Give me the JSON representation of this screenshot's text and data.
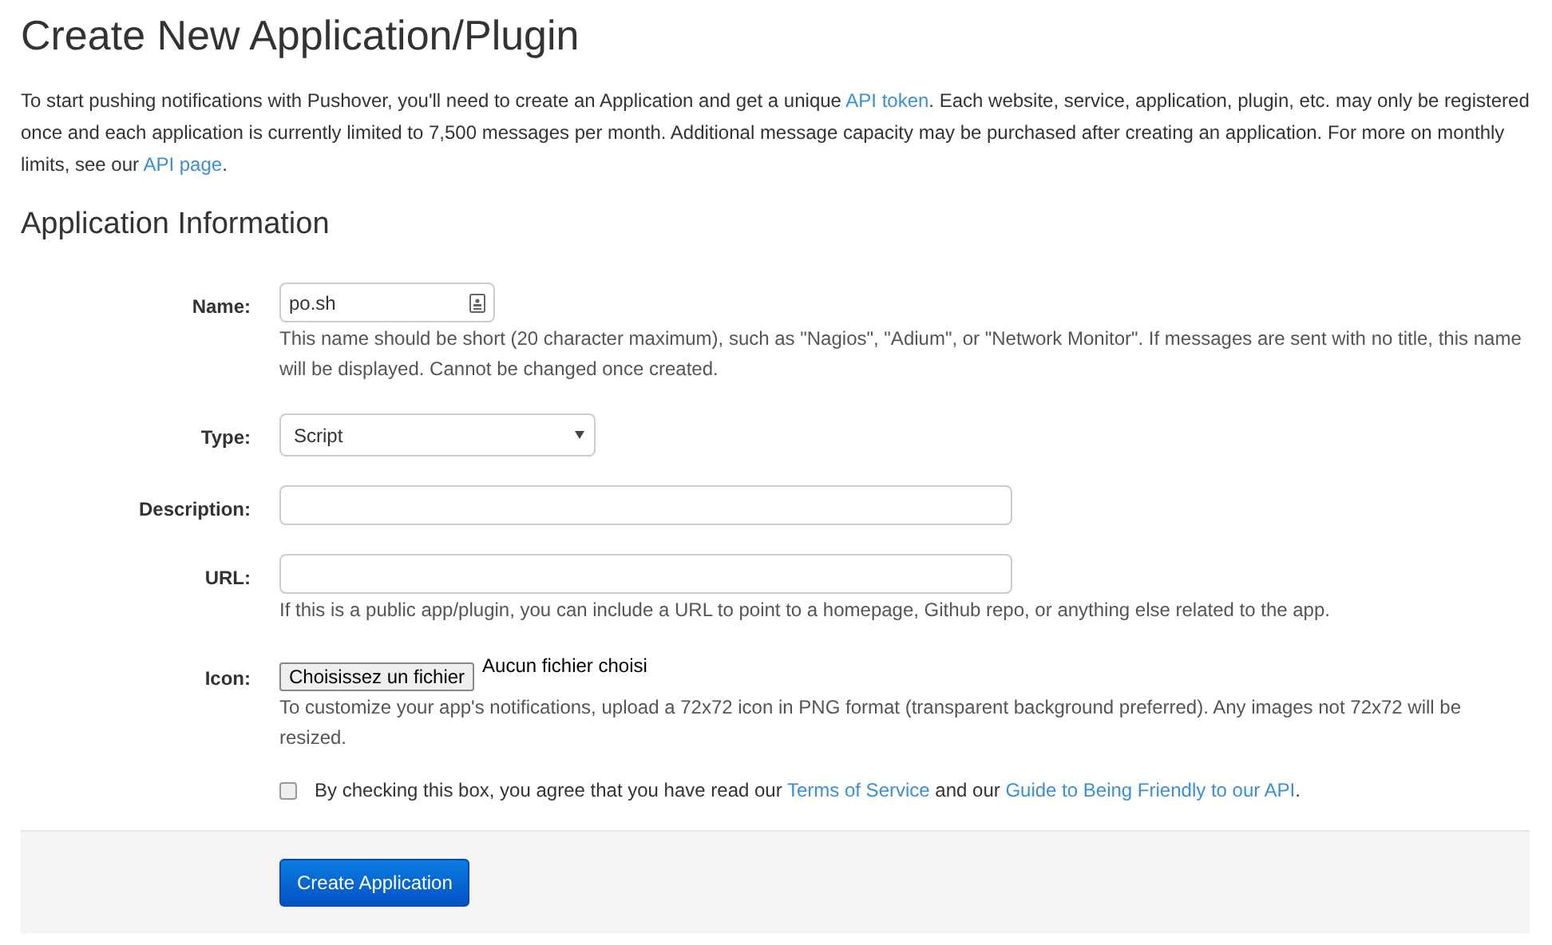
{
  "title": "Create New Application/Plugin",
  "intro": [
    {
      "kind": "text",
      "text": "To start pushing notifications with Pushover, you'll need to create an Application and get a unique "
    },
    {
      "kind": "link",
      "text": "API token"
    },
    {
      "kind": "text",
      "text": ". Each website, service, application, plugin, etc. may only be registered once and each application is currently limited to 7,500 messages per month. Additional message capacity may be purchased after creating an application. For more on monthly limits, see our "
    },
    {
      "kind": "link",
      "text": "API page"
    },
    {
      "kind": "text",
      "text": "."
    }
  ],
  "section_title": "Application Information",
  "fields": [
    {
      "kind": "short_text",
      "label": "Name:",
      "value": "po.sh",
      "help": "This name should be short (20 character maximum), such as \"Nagios\", \"Adium\", or \"Network Monitor\". If messages are sent with no title, this name will be displayed. Cannot be changed once created."
    },
    {
      "kind": "select",
      "label": "Type:",
      "value": "Script"
    },
    {
      "kind": "text",
      "label": "Description:"
    },
    {
      "kind": "text",
      "label": "URL:",
      "help": "If this is a public app/plugin, you can include a URL to point to a homepage, Github repo, or anything else related to the app."
    },
    {
      "kind": "file",
      "label": "Icon:",
      "button": "Choisissez un fichier",
      "status": "Aucun fichier choisi",
      "help": "To customize your app's notifications, upload a 72x72 icon in PNG format (transparent background preferred). Any images not 72x72 will be resized."
    }
  ],
  "agreement": {
    "checked": false,
    "parts": [
      {
        "kind": "text",
        "text": "By checking this box, you agree that you have read our "
      },
      {
        "kind": "link",
        "text": "Terms of Service"
      },
      {
        "kind": "text",
        "text": " and our "
      },
      {
        "kind": "link",
        "text": "Guide to Being Friendly to our API"
      },
      {
        "kind": "text",
        "text": "."
      }
    ]
  },
  "submit": "Create Application"
}
